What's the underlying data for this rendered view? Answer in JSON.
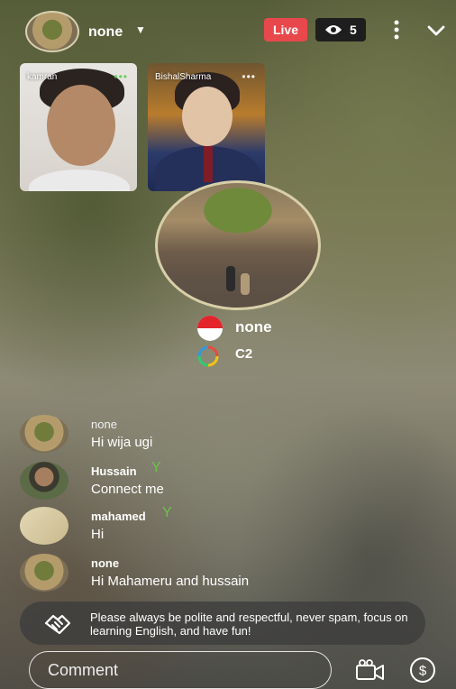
{
  "header": {
    "host_name": "none",
    "live_label": "Live",
    "viewer_count": "5"
  },
  "guests": [
    {
      "name": "kamran"
    },
    {
      "name": "BishalSharma"
    }
  ],
  "featured": {
    "name": "none",
    "level": "C2"
  },
  "chat": {
    "messages": [
      {
        "sender": "none",
        "text": "Hi wija ugi"
      },
      {
        "sender": "Hussain",
        "text": "Connect me"
      },
      {
        "sender": "mahamed",
        "text": "Hi"
      },
      {
        "sender": "none",
        "text": "Hi Mahameru and hussain"
      }
    ]
  },
  "notice": {
    "text": "Please always be polite and respectful, never spam, focus on learning English, and have fun!"
  },
  "composer": {
    "placeholder": "Comment"
  },
  "colors": {
    "live_red": "#e8484c",
    "sprout_green": "#6ec14a",
    "guest_status_green": "#62d15a"
  }
}
